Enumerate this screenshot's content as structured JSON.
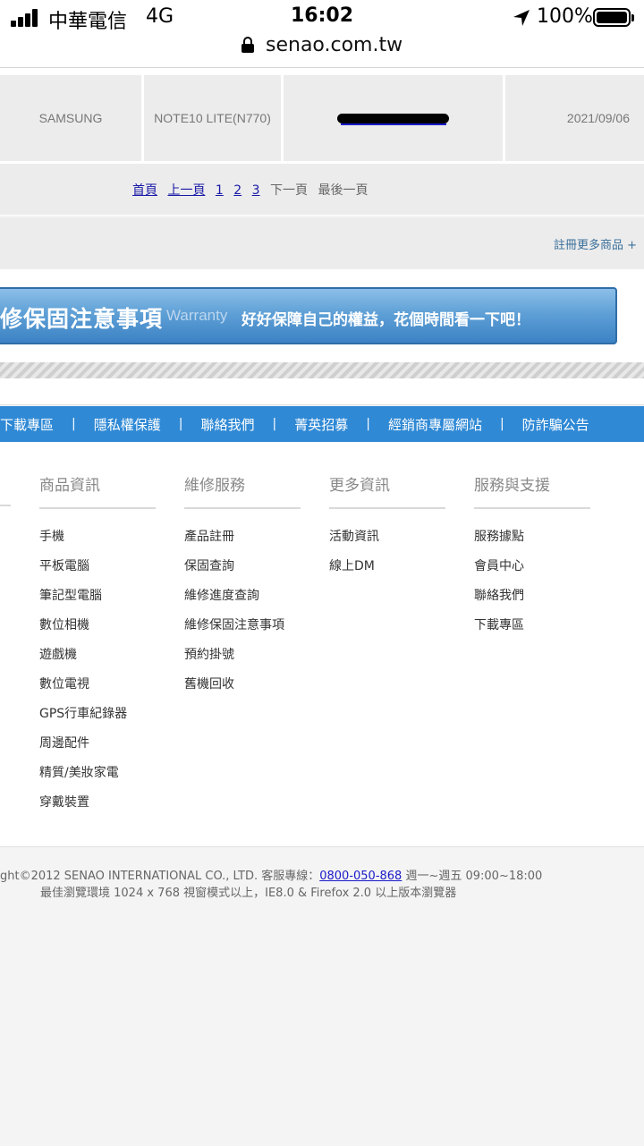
{
  "status_bar": {
    "carrier": "中華電信",
    "network": "4G",
    "time": "16:02",
    "battery_percent": "100%",
    "signal_bars": 4,
    "icons": [
      "signal-icon",
      "location-arrow-icon",
      "battery-icon"
    ]
  },
  "browser": {
    "url": "senao.com.tw",
    "lock_icon": "lock-icon"
  },
  "product_table": {
    "row": {
      "brand": "SAMSUNG",
      "model": "NOTE10 LITE(N770)",
      "serial": "(redacted)",
      "date": "2021/09/06"
    },
    "pager": {
      "first": "首頁",
      "prev": "上一頁",
      "pages": [
        "1",
        "2",
        "3"
      ],
      "next": "下一頁",
      "last": "最後一頁"
    },
    "register_more": "註冊更多商品 +"
  },
  "warranty_banner": {
    "title": "修保固注意事項",
    "english": "Warranty",
    "subtitle": "好好保障自己的權益，花個時間看一下吧！"
  },
  "footer_nav": {
    "items": [
      "下載專區",
      "隱私權保護",
      "聯絡我們",
      "菁英招募",
      "經銷商專屬網站",
      "防詐騙公告"
    ]
  },
  "footer_columns": [
    {
      "title": "商品資訊",
      "links": [
        "手機",
        "平板電腦",
        "筆記型電腦",
        "數位相機",
        "遊戲機",
        "數位電視",
        "GPS行車紀錄器",
        "周邊配件",
        "精質/美妝家電",
        "穿戴裝置"
      ]
    },
    {
      "title": "維修服務",
      "links": [
        "產品註冊",
        "保固查詢",
        "維修進度查詢",
        "維修保固注意事項",
        "預約掛號",
        "舊機回收"
      ]
    },
    {
      "title": "更多資訊",
      "links": [
        "活動資訊",
        "線上DM"
      ]
    },
    {
      "title": "服務與支援",
      "links": [
        "服務據點",
        "會員中心",
        "聯絡我們",
        "下載專區"
      ]
    }
  ],
  "copyright": {
    "line1_prefix": "ght©2012 SENAO INTERNATIONAL CO., LTD. 客服專線：",
    "phone": "0800-050-868",
    "line1_suffix": " 週一~週五 09:00~18:00",
    "line2": "最佳瀏覽環境 1024 x 768 視窗模式以上，IE8.0 & Firefox 2.0 以上版本瀏覽器"
  },
  "colors": {
    "nav_blue": "#2f89d5",
    "banner_blue": "#5fa0d6",
    "link_blue": "#1a1aa8",
    "register_link": "#3a6f9a"
  }
}
